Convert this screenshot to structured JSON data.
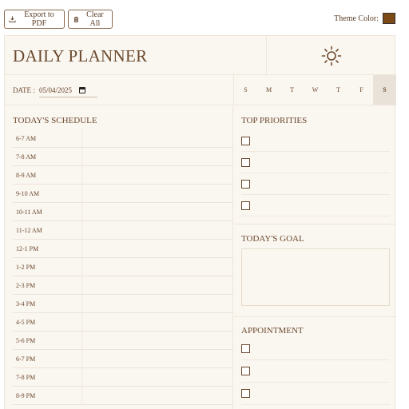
{
  "toolbar": {
    "export_label": "Export to PDF",
    "clear_label": "Clear All",
    "theme_label": "Theme Color:",
    "theme_color": "#7b4a16"
  },
  "header": {
    "title": "DAILY PLANNER",
    "icon": "sun-icon"
  },
  "date": {
    "label": "DATE :",
    "value": "05/04/2025"
  },
  "weekdays": [
    {
      "label": "S",
      "selected": false
    },
    {
      "label": "M",
      "selected": false
    },
    {
      "label": "T",
      "selected": false
    },
    {
      "label": "W",
      "selected": false
    },
    {
      "label": "T",
      "selected": false
    },
    {
      "label": "F",
      "selected": false
    },
    {
      "label": "S",
      "selected": true
    }
  ],
  "schedule": {
    "title": "TODAY'S SCHEDULE",
    "slots": [
      "6-7 AM",
      "7-8 AM",
      "8-9 AM",
      "9-10 AM",
      "10-11 AM",
      "11-12 AM",
      "12-1 PM",
      "1-2 PM",
      "2-3 PM",
      "3-4 PM",
      "4-5 PM",
      "5-6 PM",
      "6-7 PM",
      "7-8 PM",
      "8-9 PM"
    ]
  },
  "priorities": {
    "title": "TOP PRIORITIES",
    "count": 4
  },
  "goal": {
    "title": "TODAY'S GOAL",
    "value": ""
  },
  "appointment": {
    "title": "APPOINTMENT",
    "count": 3
  }
}
